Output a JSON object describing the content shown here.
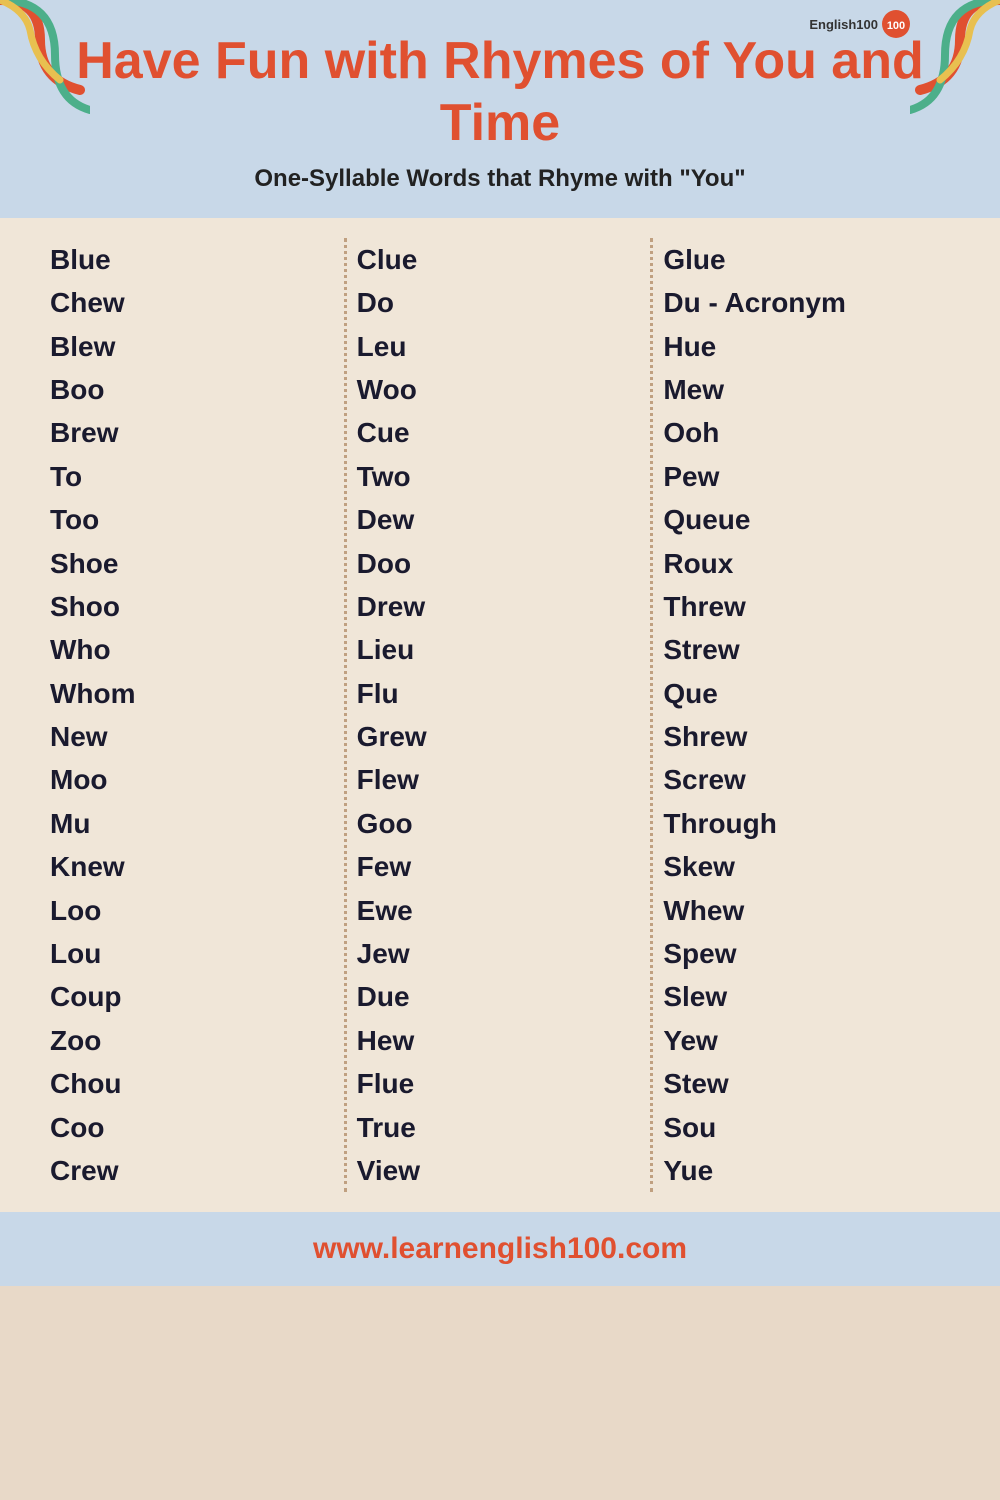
{
  "header": {
    "title": "Have Fun with Rhymes of You and Time",
    "subtitle_pre": "One-",
    "subtitle_bold": "Syllable Words that Rhyme with \"You\"",
    "badge_text": "English100"
  },
  "columns": [
    {
      "words": [
        "Blue",
        "Chew",
        "Blew",
        "Boo",
        "Brew",
        "To",
        "Too",
        "Shoe",
        "Shoo",
        "Who",
        "Whom",
        "New",
        "Moo",
        "Mu",
        "Knew",
        "Loo",
        "Lou",
        "Coup",
        "Zoo",
        "Chou",
        "Coo",
        "Crew"
      ]
    },
    {
      "words": [
        "Clue",
        "Do",
        "Leu",
        "Woo",
        "Cue",
        "Two",
        "Dew",
        "Doo",
        "Drew",
        "Lieu",
        "Flu",
        "Grew",
        "Flew",
        "Goo",
        "Few",
        "Ewe",
        "Jew",
        "Due",
        "Hew",
        "Flue",
        "True",
        "View"
      ]
    },
    {
      "words": [
        "Glue",
        "Du - Acronym",
        "Hue",
        "Mew",
        "Ooh",
        "Pew",
        "Queue",
        "Roux",
        "Threw",
        "Strew",
        "Que",
        "Shrew",
        "Screw",
        "Through",
        "Skew",
        "Whew",
        "Spew",
        "Slew",
        "Yew",
        "Stew",
        "Sou",
        "Yue"
      ]
    }
  ],
  "footer": {
    "url": "www.learnenglish100.com"
  }
}
